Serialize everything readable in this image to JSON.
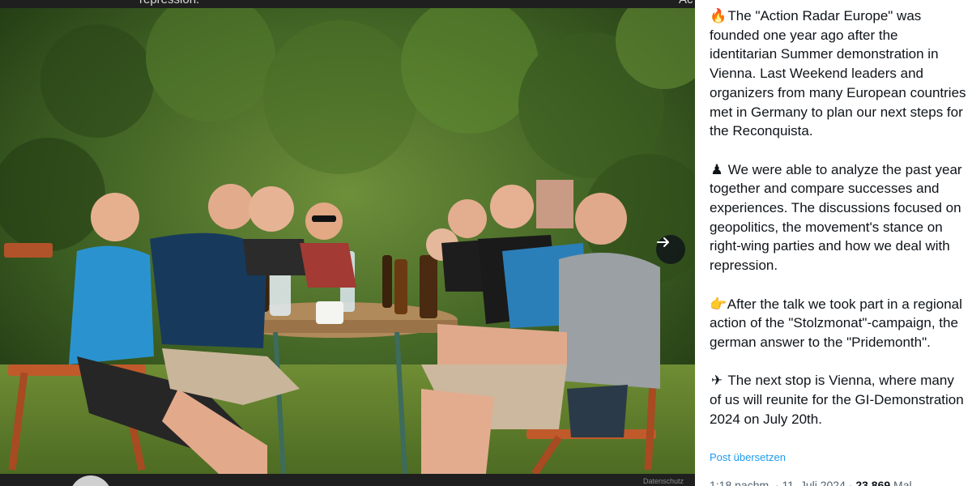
{
  "top": {
    "prev_text": "repression.",
    "prev_right": "Ac"
  },
  "media": {
    "image_alt": "Group photo of men sitting at a table outdoors",
    "next_icon": "arrow-right-icon"
  },
  "post": {
    "paragraphs": [
      {
        "emoji": "🔥",
        "text": "The \"Action Radar Europe\" was founded one year ago after the identitarian Summer demonstration in Vienna. Last Weekend leaders and organizers from many European countries met in Germany to plan our next steps for the Reconquista."
      },
      {
        "emoji": "♟",
        "text": "We were able to analyze the past year together and compare successes and experiences. The discussions focused on geopolitics, the movement's stance on right-wing parties and how we deal with repression."
      },
      {
        "emoji": "👉",
        "text": "After the talk we took part in a regional action of the \"Stolzmonat\"-campaign, the german answer to the \"Pridemonth\"."
      },
      {
        "emoji": "✈",
        "text": "The next stop is Vienna, where many of us will reunite for the GI-Demonstration 2024 on July 20th."
      }
    ],
    "translate_label": "Post übersetzen",
    "time": "1:18 nachm.",
    "date": "11. Juli 2024",
    "views_count": "23.869",
    "views_label": "Mal"
  },
  "bottom": {
    "right_text": "Datenschutz"
  },
  "colors": {
    "link": "#1d9bf0",
    "text": "#0f1419",
    "meta": "#536471",
    "background_dark": "#1f1f1f"
  }
}
